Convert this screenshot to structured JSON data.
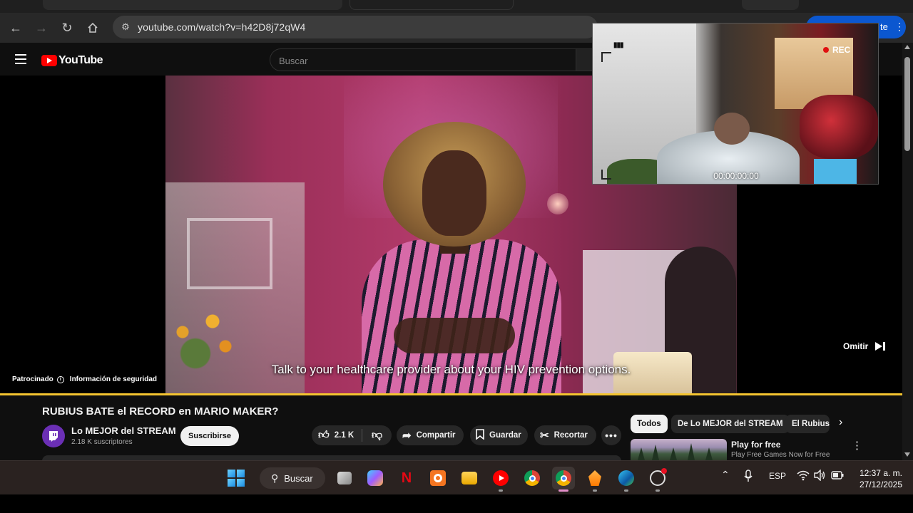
{
  "browser": {
    "url": "youtube.com/watch?v=h42D8j72qW4",
    "profile_button_label": "te"
  },
  "youtube": {
    "logo_text": "YouTube",
    "search_placeholder": "Buscar",
    "ad": {
      "caption": "Talk to your healthcare provider about your HIV prevention options.",
      "sponsored_label": "Patrocinado",
      "safety_info_label": "Información de seguridad",
      "skip_label": "Omitir",
      "progress": 1.0,
      "progress_color": "#f4c430"
    },
    "video": {
      "title": "RUBIUS BATE el RECORD en MARIO MAKER?",
      "channel_name": "Lo MEJOR del STREAM",
      "subscribers": "2.18 K suscriptores",
      "subscribe_label": "Suscribirse",
      "likes": "2.1 K",
      "share_label": "Compartir",
      "save_label": "Guardar",
      "clip_label": "Recortar"
    },
    "chips": [
      "Todos",
      "De Lo MEJOR del STREAM",
      "El Rubius"
    ],
    "suggestion": {
      "title": "Play for free",
      "subtitle": "Play Free Games Now for Free"
    }
  },
  "webcam_overlay": {
    "rec_label": "REC",
    "timecode": "00:00:00:00",
    "battery_glyph": "▮▮▮"
  },
  "taskbar": {
    "search_label": "Buscar",
    "language": "ESP",
    "time": "12:37 a. m.",
    "date": "27/12/2025",
    "apps": [
      "windows-start",
      "search",
      "task-view",
      "copilot",
      "netflix",
      "crunchyroll",
      "file-explorer",
      "youtube-music",
      "chrome",
      "chrome-active",
      "fl-studio",
      "edge",
      "steam"
    ]
  },
  "colors": {
    "youtube_red": "#ff0000",
    "accent_blue": "#0b57d0",
    "active_indicator": "#e38ec9"
  }
}
